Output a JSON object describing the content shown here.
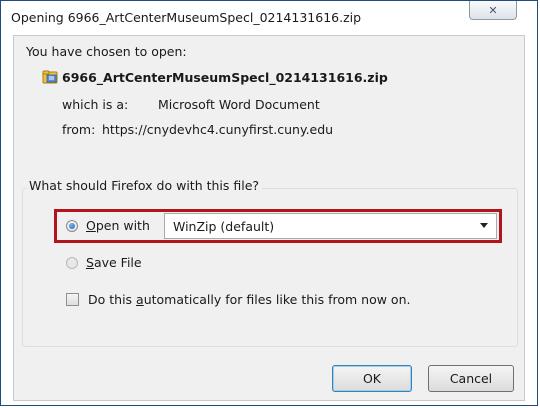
{
  "dialog": {
    "title": "Opening 6966_ArtCenterMuseumSpecl_0214131616.zip",
    "close_glyph": "✕"
  },
  "file_info": {
    "chosen_label": "You have chosen to open:",
    "filename": "6966_ArtCenterMuseumSpecl_0214131616.zip",
    "type_label": "which is a:",
    "type_value": "Microsoft Word Document",
    "from_label": "from:",
    "from_value": "https://cnydevhc4.cunyfirst.cuny.edu",
    "icon": "zip-archive-icon"
  },
  "action_group": {
    "label": "What should Firefox do with this file?",
    "open_with": {
      "mnemonic": "O",
      "rest": "pen with",
      "selected": true,
      "app_value": "WinZip (default)"
    },
    "save_file": {
      "mnemonic": "S",
      "rest": "ave File",
      "selected": false
    },
    "auto": {
      "before": "Do this ",
      "mnemonic": "a",
      "after": "utomatically for files like this from now on.",
      "checked": false
    }
  },
  "buttons": {
    "ok": "OK",
    "cancel": "Cancel"
  },
  "colors": {
    "highlight_border": "#b1141d",
    "dialog_border": "#1f4d7a"
  }
}
